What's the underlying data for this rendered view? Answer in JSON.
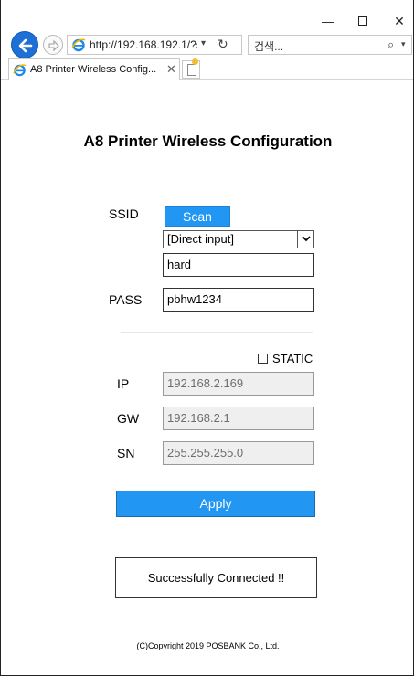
{
  "window": {
    "minimize_glyph": "—",
    "close_glyph": "✕"
  },
  "nav": {
    "url": "http://192.168.192.1/?ssi",
    "search_placeholder": "검색...",
    "dropdown_glyph": "▾",
    "refresh_glyph": "↻",
    "search_glyph": "⌕"
  },
  "tabs": [
    {
      "label": "A8 Printer Wireless Config...",
      "close_glyph": "✕"
    }
  ],
  "page": {
    "title": "A8 Printer Wireless Configuration",
    "ssid_label": "SSID",
    "scan_label": "Scan",
    "ssid_select_value": "[Direct input]",
    "ssid_value": "hard",
    "pass_label": "PASS",
    "pass_value": "pbhw1234",
    "static_label": "STATIC",
    "static_checked": false,
    "ip_label": "IP",
    "ip_value": "192.168.2.169",
    "gw_label": "GW",
    "gw_value": "192.168.2.1",
    "sn_label": "SN",
    "sn_value": "255.255.255.0",
    "apply_label": "Apply",
    "status_message": "Successfully Connected !!",
    "copyright": "(C)Copyright 2019 POSBANK Co., Ltd."
  },
  "colors": {
    "accent": "#2196f3",
    "back_button": "#1e6fd6",
    "disabled_field": "#efefef"
  }
}
